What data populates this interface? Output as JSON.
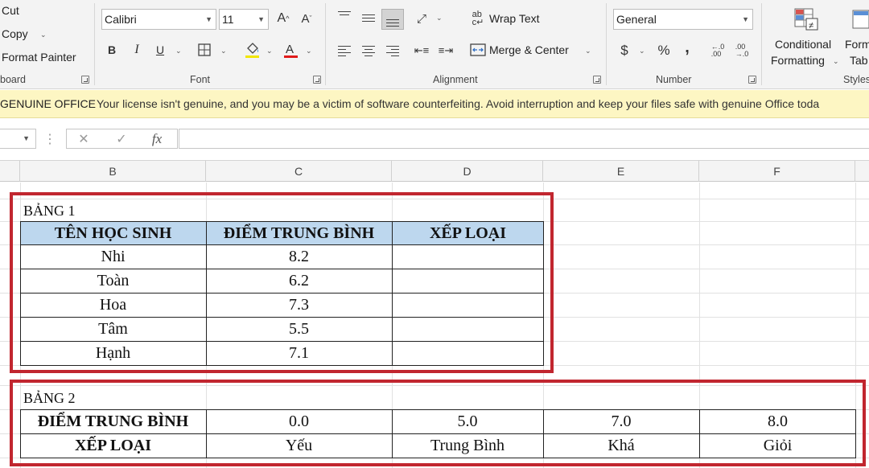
{
  "ribbon": {
    "clipboard": {
      "cut": "Cut",
      "copy": "Copy",
      "format_painter": "Format Painter",
      "group_label": "board"
    },
    "font": {
      "name": "Calibri",
      "size": "11",
      "group_label": "Font",
      "bold": "B",
      "italic": "I",
      "underline": "U",
      "font_color": "#e01b1b"
    },
    "alignment": {
      "wrap_text": "Wrap Text",
      "merge_center": "Merge & Center",
      "group_label": "Alignment"
    },
    "number": {
      "format": "General",
      "currency": "$",
      "percent": "%",
      "comma": ",",
      "group_label": "Number"
    },
    "styles": {
      "conditional_1": "Conditional",
      "conditional_2": "Formatting",
      "format_table_1": "Form",
      "format_table_2": "Tab",
      "group_label": "Styles"
    }
  },
  "license_bar": {
    "tag": "GENUINE OFFICE",
    "message": "Your license isn't genuine, and you may be a victim of software counterfeiting. Avoid interruption and keep your files safe with genuine Office toda"
  },
  "formula_bar": {
    "cancel": "✕",
    "enter": "✓",
    "fx": "fx"
  },
  "columns": [
    "B",
    "C",
    "D",
    "E",
    "F"
  ],
  "table1": {
    "title": "BẢNG 1",
    "headers": [
      "TÊN HỌC SINH",
      "ĐIỂM TRUNG BÌNH",
      "XẾP LOẠI"
    ],
    "rows": [
      [
        "Nhi",
        "8.2",
        ""
      ],
      [
        "Toàn",
        "6.2",
        ""
      ],
      [
        "Hoa",
        "7.3",
        ""
      ],
      [
        "Tâm",
        "5.5",
        ""
      ],
      [
        "Hạnh",
        "7.1",
        ""
      ]
    ],
    "header_fill": "#bdd7ee"
  },
  "table2": {
    "title": "BẢNG 2",
    "row1_label": "ĐIỂM TRUNG BÌNH",
    "row1_values": [
      "0.0",
      "5.0",
      "7.0",
      "8.0"
    ],
    "row2_label": "XẾP LOẠI",
    "row2_values": [
      "Yếu",
      "Trung Bình",
      "Khá",
      "Giỏi"
    ]
  },
  "highlight_color": "#c1262f"
}
